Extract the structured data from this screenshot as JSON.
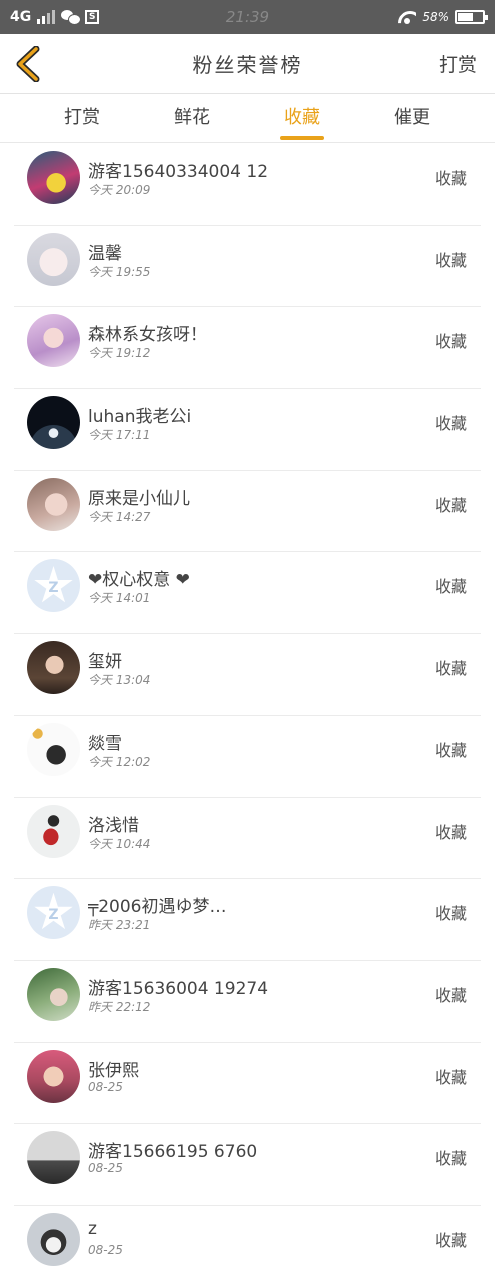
{
  "status_bar": {
    "network": "4G",
    "s_badge": "S",
    "time": "21:39",
    "battery": "58%"
  },
  "header": {
    "title": "粉丝荣誉榜",
    "right_label": "打赏"
  },
  "tabs": [
    {
      "label": "打赏"
    },
    {
      "label": "鲜花"
    },
    {
      "label": "收藏"
    },
    {
      "label": "催更"
    }
  ],
  "active_tab_index": 2,
  "accent_color": "#e9a21a",
  "fans": [
    {
      "name": "游客15640334004 12",
      "time": "今天 20:09",
      "action": "收藏"
    },
    {
      "name": "温馨",
      "time": "今天 19:55",
      "action": "收藏"
    },
    {
      "name": "森林系女孩呀！",
      "time": "今天 19:12",
      "action": "收藏"
    },
    {
      "name": "luhan我老公i",
      "time": "今天 17:11",
      "action": "收藏"
    },
    {
      "name": "原来是小仙儿",
      "time": "今天 14:27",
      "action": "收藏"
    },
    {
      "name": "❤权心权意 ❤",
      "time": "今天 14:01",
      "action": "收藏"
    },
    {
      "name": "玺妍",
      "time": "今天 13:04",
      "action": "收藏"
    },
    {
      "name": "燚雪",
      "time": "今天 12:02",
      "action": "收藏"
    },
    {
      "name": "洛浅惜",
      "time": "今天 10:44",
      "action": "收藏"
    },
    {
      "name": "╤2006初遇ゆ梦…",
      "time": "昨天 23:21",
      "action": "收藏"
    },
    {
      "name": "游客15636004 19274",
      "time": "昨天 22:12",
      "action": "收藏"
    },
    {
      "name": "张伊熙",
      "time": "08-25",
      "action": "收藏"
    },
    {
      "name": "游客15666195 6760",
      "time": "08-25",
      "action": "收藏"
    },
    {
      "name": "z",
      "time": "08-25",
      "action": "收藏"
    }
  ]
}
